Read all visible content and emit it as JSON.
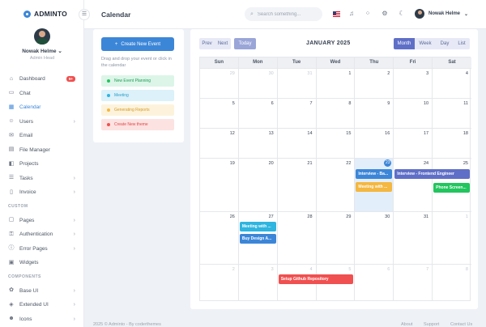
{
  "brand": {
    "name": "ADMINTO"
  },
  "user": {
    "name": "Nowak Helme",
    "role": "Admin Head",
    "chevron": "⌄"
  },
  "sidebar": {
    "items": [
      {
        "label": "Dashboard",
        "icon": "⌂",
        "icon_name": "home-icon",
        "badge": "9+"
      },
      {
        "label": "Chat",
        "icon": "▭",
        "icon_name": "chat-icon"
      },
      {
        "label": "Calendar",
        "icon": "▦",
        "icon_name": "calendar-icon",
        "active": true
      },
      {
        "label": "Users",
        "icon": "☺",
        "icon_name": "users-icon",
        "chevron": "›"
      },
      {
        "label": "Email",
        "icon": "✉",
        "icon_name": "mail-icon"
      },
      {
        "label": "File Manager",
        "icon": "▤",
        "icon_name": "folder-icon"
      },
      {
        "label": "Projects",
        "icon": "◧",
        "icon_name": "projects-icon"
      },
      {
        "label": "Tasks",
        "icon": "☰",
        "icon_name": "tasks-icon",
        "chevron": "›"
      },
      {
        "label": "Invoice",
        "icon": "▯",
        "icon_name": "invoice-icon",
        "chevron": "›"
      }
    ],
    "section_custom": "CUSTOM",
    "custom_items": [
      {
        "label": "Pages",
        "icon": "▢",
        "icon_name": "pages-icon",
        "chevron": "›"
      },
      {
        "label": "Authentication",
        "icon": "⚿",
        "icon_name": "key-icon",
        "chevron": "›"
      },
      {
        "label": "Error Pages",
        "icon": "ⓘ",
        "icon_name": "error-icon",
        "chevron": "›"
      },
      {
        "label": "Widgets",
        "icon": "▣",
        "icon_name": "widgets-icon"
      }
    ],
    "section_components": "COMPONENTS",
    "component_items": [
      {
        "label": "Base UI",
        "icon": "✿",
        "icon_name": "base-ui-icon",
        "chevron": "›"
      },
      {
        "label": "Extended UI",
        "icon": "◈",
        "icon_name": "extended-ui-icon",
        "chevron": "›"
      },
      {
        "label": "Icons",
        "icon": "☻",
        "icon_name": "icons-icon",
        "chevron": "›"
      }
    ]
  },
  "topbar": {
    "title": "Calendar",
    "search_placeholder": "Search something...",
    "menu_icon": "☰",
    "search_icon": "⌕",
    "icons": [
      {
        "name": "bell-icon",
        "glyph": "♫"
      },
      {
        "name": "apps-icon",
        "glyph": "⁘"
      },
      {
        "name": "settings-icon",
        "glyph": "⚙"
      },
      {
        "name": "moon-icon",
        "glyph": "☾"
      }
    ],
    "user_name": "Nowak Helme",
    "user_chevron": "⌄"
  },
  "events_panel": {
    "create_label": "Create New Event",
    "create_icon": "+",
    "drag_text": "Drag and drop your event or click in the calendar",
    "chips": [
      {
        "label": "New Event Planning",
        "bg": "#dcf5e8",
        "dot": "#22c55e",
        "color": "#1f9d55"
      },
      {
        "label": "Meeting",
        "bg": "#dcf1fa",
        "dot": "#2eb5e0",
        "color": "#2a9fc8"
      },
      {
        "label": "Generating Reports",
        "bg": "#fdf3dc",
        "dot": "#f4b740",
        "color": "#d59a23"
      },
      {
        "label": "Create New theme",
        "bg": "#fde2e2",
        "dot": "#f05050",
        "color": "#e04848"
      }
    ]
  },
  "calendar": {
    "title": "JANUARY 2025",
    "prev": "Prev",
    "next": "Next",
    "today": "Today",
    "views": [
      "Month",
      "Week",
      "Day",
      "List"
    ],
    "days_of_week": [
      "Sun",
      "Mon",
      "Tue",
      "Wed",
      "Thu",
      "Fri",
      "Sat"
    ],
    "weeks": [
      [
        "29",
        "30",
        "31",
        "1",
        "2",
        "3",
        "4"
      ],
      [
        "5",
        "6",
        "7",
        "8",
        "9",
        "10",
        "11"
      ],
      [
        "12",
        "13",
        "14",
        "15",
        "16",
        "17",
        "18"
      ],
      [
        "19",
        "20",
        "21",
        "22",
        "23",
        "24",
        "25"
      ],
      [
        "26",
        "27",
        "28",
        "29",
        "30",
        "31",
        "1"
      ],
      [
        "2",
        "3",
        "4",
        "5",
        "6",
        "7",
        "8"
      ]
    ],
    "events": [
      {
        "label": "Interview - Ba...",
        "color": "#3c86d8"
      },
      {
        "label": "Interview - Frontend Engineer",
        "color": "#5f6fc7"
      },
      {
        "label": "Meeting with ...",
        "color": "#f4b740"
      },
      {
        "label": "Phone Screen...",
        "color": "#22c55e"
      },
      {
        "label": "Meeting with ...",
        "color": "#2eb5e0"
      },
      {
        "label": "Buy Design A...",
        "color": "#3c86d8"
      },
      {
        "label": "Setup Github Repository",
        "color": "#f05050"
      }
    ]
  },
  "footer": {
    "copyright": "2025 © Adminto - By coderthemes",
    "links": [
      "About",
      "Support",
      "Contact Us"
    ]
  }
}
